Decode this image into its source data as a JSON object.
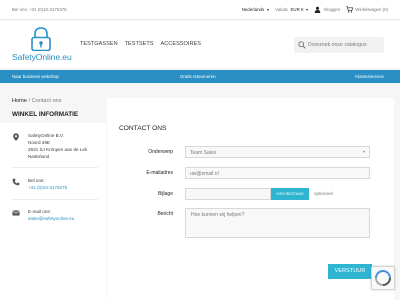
{
  "topbar": {
    "phone": "Bel ons: +31 (0)10-3176375",
    "language": "Nederlands",
    "currency_label": "Valuta:",
    "currency": "EUR €",
    "login": "Inloggen",
    "cart": "Winkelwagen (0)"
  },
  "header": {
    "logo_text": "SafetyOnline.eu",
    "nav": [
      "Testgassen",
      "Testsets",
      "Accessoires"
    ],
    "search_placeholder": "Doorzoek onze catalogus"
  },
  "bluebar": {
    "left": "Naar business webshop",
    "center": "Gratis retourneren",
    "right": "Klantenservice"
  },
  "breadcrumb": {
    "home": "Home",
    "separator": "/",
    "current": "Contact ons"
  },
  "sidebar": {
    "title": "WINKEL INFORMATIE",
    "address": [
      "SafetyOnline B.V.",
      "Noord 49E",
      "2931 SJ Krimpen aan de Lek",
      "Nederland"
    ],
    "phone_label": "Bel ons:",
    "phone": "+31 (0)10-3176375",
    "email_label": "E-mail ons:",
    "email": "sales@safetyonline.eu"
  },
  "contact": {
    "title": "CONTACT ONS",
    "subject_label": "Onderwerp",
    "subject_value": "Team Sales",
    "email_label": "E-mailadres",
    "email_placeholder": "uw@email.nl",
    "attachment_label": "Bijlage",
    "file_button": "KIES BESTAND",
    "optional": "optioneel",
    "message_label": "Bericht",
    "message_placeholder": "Hoe kunnen wij helpen?",
    "submit": "VERSTUUR"
  },
  "colors": {
    "accent": "#2fb5d2",
    "brand": "#2a8fc4"
  },
  "icons": [
    "user-icon",
    "cart-icon",
    "search-icon",
    "location-icon",
    "phone-icon",
    "mail-icon",
    "recaptcha-icon"
  ]
}
